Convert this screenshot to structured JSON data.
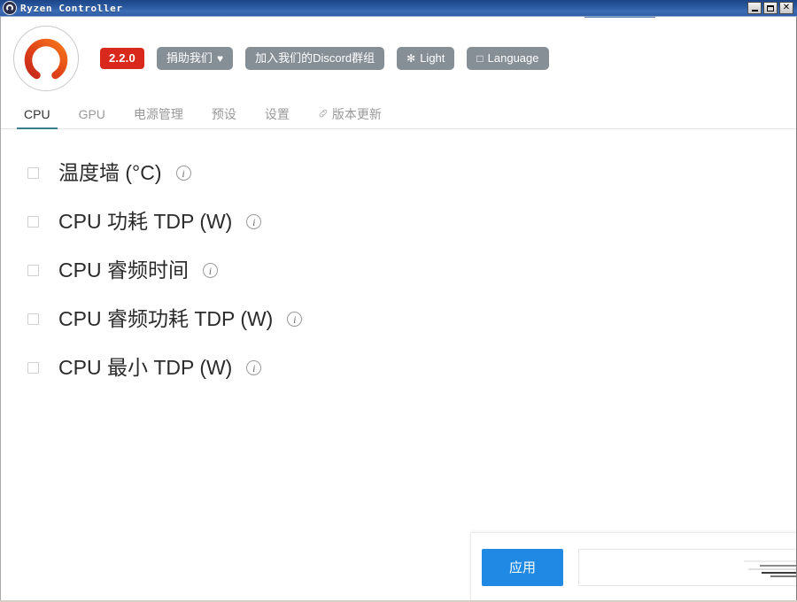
{
  "window": {
    "title": "Ryzen Controller",
    "icon": "app-logo-icon",
    "controls": {
      "minimize_label": "Minimize",
      "maximize_label": "Maximize",
      "close_label": "Close",
      "close_glyph": "✕"
    }
  },
  "header": {
    "logo_name": "ryzen-controller-logo",
    "version_badge": "2.2.0",
    "buttons": [
      {
        "name": "donate-button",
        "label": "捐助我们",
        "icon": "♥",
        "icon_name": "heart-icon",
        "icon_position": "after"
      },
      {
        "name": "discord-button",
        "label": "加入我们的Discord群组",
        "icon": "",
        "icon_name": "",
        "icon_position": "none"
      },
      {
        "name": "theme-button",
        "label": "Light",
        "icon": "✻",
        "icon_name": "sun-icon",
        "icon_position": "before"
      },
      {
        "name": "language-button",
        "label": "Language",
        "icon": "□",
        "icon_name": "globe-icon",
        "icon_position": "before"
      }
    ]
  },
  "tabs": [
    {
      "name": "tab-cpu",
      "label": "CPU",
      "active": true,
      "icon": "",
      "icon_name": ""
    },
    {
      "name": "tab-gpu",
      "label": "GPU",
      "active": false,
      "icon": "",
      "icon_name": ""
    },
    {
      "name": "tab-power-management",
      "label": "电源管理",
      "active": false,
      "icon": "",
      "icon_name": ""
    },
    {
      "name": "tab-presets",
      "label": "预设",
      "active": false,
      "icon": "",
      "icon_name": ""
    },
    {
      "name": "tab-settings",
      "label": "设置",
      "active": false,
      "icon": "",
      "icon_name": ""
    },
    {
      "name": "tab-version-update",
      "label": "版本更新",
      "active": false,
      "icon": "🔗",
      "icon_name": "link-icon"
    }
  ],
  "cpu_options": [
    {
      "name": "option-temperature-limit",
      "label": "温度墙 (°C)",
      "checked": false,
      "info": "i"
    },
    {
      "name": "option-cpu-tdp",
      "label": "CPU 功耗 TDP (W)",
      "checked": false,
      "info": "i"
    },
    {
      "name": "option-cpu-boost-time",
      "label": "CPU 睿频时间",
      "checked": false,
      "info": "i"
    },
    {
      "name": "option-cpu-boost-tdp",
      "label": "CPU 睿频功耗 TDP (W)",
      "checked": false,
      "info": "i"
    },
    {
      "name": "option-cpu-min-tdp",
      "label": "CPU 最小 TDP (W)",
      "checked": false,
      "info": "i"
    }
  ],
  "footer": {
    "apply_label": "应用"
  },
  "colors": {
    "title_bar": "#27559c",
    "accent_blue": "#2089e4",
    "version_red": "#d9291c",
    "button_gray": "#868e96",
    "tab_underline": "#3a7d8c",
    "logo_red": "#d42a1e",
    "logo_orange": "#f7711a"
  }
}
